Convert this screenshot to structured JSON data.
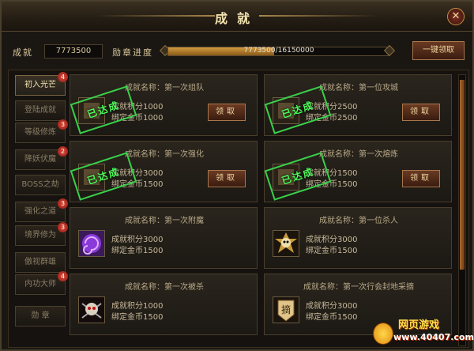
{
  "window": {
    "title": "成就",
    "close_glyph": "✕"
  },
  "summary": {
    "score_label": "成就",
    "score_value": "7773500",
    "progress_label": "勋章进度",
    "progress_text": "7773500/16150000",
    "progress_fraction": 0.481,
    "claim_all_label": "一键领取"
  },
  "tabs": [
    {
      "label": "初入光芒",
      "badge": "4",
      "active": true
    },
    {
      "label": "登陆成就",
      "badge": ""
    },
    {
      "label": "等级修炼",
      "badge": "3"
    },
    {
      "label": "降妖伏魔",
      "badge": "2"
    },
    {
      "label": "BOSS之劫",
      "badge": ""
    },
    {
      "label": "强化之道",
      "badge": "3"
    },
    {
      "label": "境界修为",
      "badge": "3"
    },
    {
      "label": "傲视群雄",
      "badge": ""
    },
    {
      "label": "内功大师",
      "badge": "4"
    },
    {
      "label": "勋  章",
      "badge": ""
    }
  ],
  "achievements": [
    {
      "name": "成就名称：第一次组队",
      "points": "成就积分1000",
      "gold": "绑定金币1000",
      "button": "领取",
      "stamp": "已达成",
      "icon": "team-icon"
    },
    {
      "name": "成就名称：第一位攻城",
      "points": "成就积分2500",
      "gold": "绑定金币2500",
      "button": "领取",
      "stamp": "已达成",
      "icon": "siege-icon"
    },
    {
      "name": "成就名称：第一次强化",
      "points": "成就积分3000",
      "gold": "绑定金币1500",
      "button": "领取",
      "stamp": "已达成",
      "icon": "enhance-icon"
    },
    {
      "name": "成就名称：第一次熔炼",
      "points": "成就积分1500",
      "gold": "绑定金币1500",
      "button": "领取",
      "stamp": "已达成",
      "icon": "smelt-icon"
    },
    {
      "name": "成就名称：第一次附魔",
      "points": "成就积分3000",
      "gold": "绑定金币1500",
      "button": "",
      "stamp": "",
      "icon": "enchant-swirl-icon"
    },
    {
      "name": "成就名称：第一位杀人",
      "points": "成就积分3000",
      "gold": "绑定金币1500",
      "button": "",
      "stamp": "",
      "icon": "skull-gear-icon"
    },
    {
      "name": "成就名称：第一次被杀",
      "points": "成就积分1000",
      "gold": "绑定金币1500",
      "button": "",
      "stamp": "",
      "icon": "red-skull-icon"
    },
    {
      "name": "成就名称：第一次行会封地采摘",
      "points": "成就积分3000",
      "gold": "绑定金币1500",
      "button": "",
      "stamp": "",
      "icon": "pick-badge-icon"
    }
  ],
  "pick_badge_char": "摘",
  "watermark": {
    "title": "网页游戏",
    "url": "www.40407.com"
  }
}
